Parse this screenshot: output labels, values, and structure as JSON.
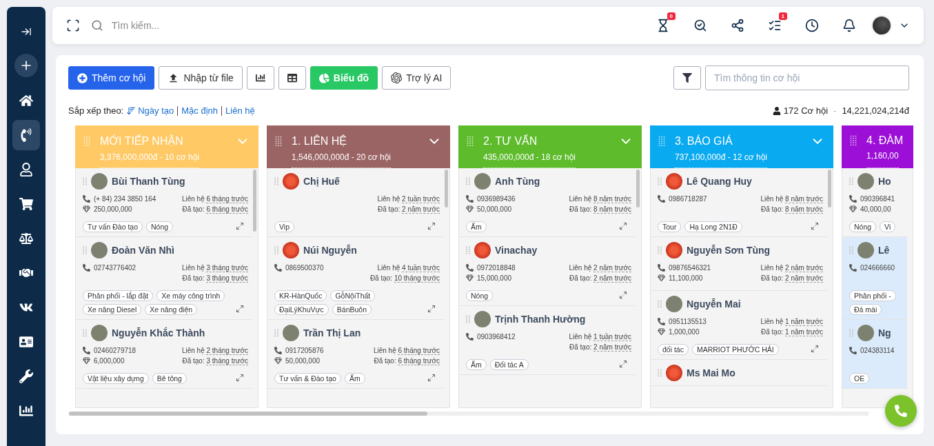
{
  "sidebar": {
    "items": [
      {
        "selected": false
      },
      {
        "selected": false
      },
      {
        "selected": false
      },
      {
        "selected": true
      },
      {
        "selected": false
      },
      {
        "selected": false
      },
      {
        "selected": false
      },
      {
        "selected": false
      },
      {
        "selected": false
      },
      {
        "selected": false
      },
      {
        "selected": false
      },
      {
        "selected": false
      }
    ]
  },
  "topbar": {
    "search": {
      "placeholder": "Tìm kiếm..."
    },
    "badges": [
      "0",
      "1"
    ]
  },
  "toolbar": {
    "buttons": [
      {
        "kind": "primary",
        "label": "Thêm cơ hội"
      },
      {
        "kind": "outline",
        "label": "Nhập từ file"
      },
      {
        "kind": "icon"
      },
      {
        "kind": "icon"
      },
      {
        "kind": "success",
        "label": "Biểu đồ"
      },
      {
        "kind": "outline",
        "label": "Trợ lý AI"
      }
    ],
    "search": {
      "placeholder": "Tìm thông tin cơ hội"
    }
  },
  "sort": {
    "label": "Sắp xếp theo:",
    "options": [
      "Ngày tạo",
      "Mặc định",
      "Liên hệ"
    ]
  },
  "stats": {
    "count": "172 Cơ hội",
    "separator": "·",
    "total": "14,221,024,214đ"
  },
  "columns": [
    {
      "title": "MỚI TIẾP NHẬN",
      "summary": "3,376,000,000đ - 10 cơ hội",
      "color": "#ffc966",
      "cards": [
        {
          "name": "Bùi Thanh Tùng",
          "kind": "photo",
          "phone": "(+ 84) 234 3850 164",
          "value": "250,000,000",
          "contact": [
            "Liên hệ",
            "6 tháng trước"
          ],
          "created": [
            "Đã tạo:",
            "6 tháng trước"
          ],
          "tags": [
            "Tư vấn Đào tạo",
            "Nóng"
          ],
          "highlighted": false
        },
        {
          "name": "Đoàn Văn Nhì",
          "kind": "photo",
          "phone": "02743776402",
          "contact": [
            "Liên hệ",
            "3 tháng trước"
          ],
          "created": [
            "Đã tạo:",
            "3 tháng trước"
          ],
          "tags": [
            "Phân phối - lắp đặt",
            "Xe máy công trình",
            "Xe nâng Diesel",
            "Xe nâng điện"
          ],
          "highlighted": false
        },
        {
          "name": "Nguyễn Khắc Thành",
          "kind": "photo",
          "phone": "02460279718",
          "value": "6,000,000",
          "contact": [
            "Liên hệ",
            "2 tháng trước"
          ],
          "created": [
            "Đã tạo:",
            "3 tháng trước"
          ],
          "tags": [
            "Vật liệu xây dựng",
            "Bê tông"
          ],
          "highlighted": false
        }
      ]
    },
    {
      "title": "1. LIÊN HỆ",
      "summary": "1,546,000,000đ - 20 cơ hội",
      "color": "#9b6464",
      "cards": [
        {
          "name": "Chị Huế",
          "kind": "logo",
          "contact": [
            "Liên hệ",
            "2 tuần trước"
          ],
          "created": [
            "Đã tạo:",
            "2 năm trước"
          ],
          "tags": [
            "Vip"
          ],
          "highlighted": false
        },
        {
          "name": "Núi Nguyễn",
          "kind": "logo",
          "phone": "0869500370",
          "contact": [
            "Liên hệ",
            "4 tuần trước"
          ],
          "created": [
            "Đã tạo:",
            "10 tháng trước"
          ],
          "tags": [
            "KR-HànQuốc",
            "GỗNộiThất",
            "ĐạiLýKhuVực",
            "BánBuôn"
          ],
          "highlighted": false
        },
        {
          "name": "Trần Thị Lan",
          "kind": "photo",
          "phone": "0917205876",
          "value": "50,000,000",
          "contact": [
            "Liên hệ",
            "6 tháng trước"
          ],
          "created": [
            "Đã tạo:",
            "6 tháng trước"
          ],
          "tags": [
            "Tư vấn & Đào tạo",
            "Ấm"
          ],
          "highlighted": false
        }
      ]
    },
    {
      "title": "2. TƯ VẤN",
      "summary": "435,000,000đ - 18 cơ hội",
      "color": "#5dbb2c",
      "cards": [
        {
          "name": "Anh Tùng",
          "kind": "photo",
          "phone": "0936989436",
          "value": "50,000,000",
          "contact": [
            "Liên hệ",
            "8 năm trước"
          ],
          "created": [
            "Đã tạo:",
            "8 năm trước"
          ],
          "tags": [
            "Ấm"
          ],
          "highlighted": false
        },
        {
          "name": "Vinachay",
          "kind": "logo",
          "phone": "0972018848",
          "value": "15,000,000",
          "contact": [
            "Liên hệ",
            "2 năm trước"
          ],
          "created": [
            "Đã tạo:",
            "2 năm trước"
          ],
          "tags": [
            "Nóng"
          ],
          "highlighted": false
        },
        {
          "name": "Trịnh Thanh Hường",
          "kind": "photo",
          "phone": "0903968412",
          "contact": [
            "Liên hệ",
            "1 tuần trước"
          ],
          "created": [
            "Đã tạo:",
            "2 năm trước"
          ],
          "tags": [
            "Ấm",
            "Đối tác A"
          ],
          "highlighted": false
        }
      ]
    },
    {
      "title": "3. BÁO GIÁ",
      "summary": "737,100,000đ - 12 cơ hội",
      "color": "#0aaaf0",
      "cards": [
        {
          "name": "Lê Quang Huy",
          "kind": "logo",
          "phone": "0986718287",
          "contact": [
            "Liên hệ",
            "8 năm trước"
          ],
          "created": [
            "Đã tạo:",
            "8 năm trước"
          ],
          "tags": [
            "Tour",
            "Hạ Long 2N1Đ"
          ],
          "highlighted": false
        },
        {
          "name": "Nguyễn Sơn Tùng",
          "kind": "logo",
          "phone": "09876546321",
          "value": "11,100,000",
          "contact": [
            "Liên hệ",
            "2 năm trước"
          ],
          "created": [
            "Đã tạo:",
            "2 năm trước"
          ],
          "highlighted": false
        },
        {
          "name": "Nguyễn Mai",
          "kind": "photo",
          "phone": "0951135513",
          "value": "1,000,000",
          "contact": [
            "Liên hệ",
            "1 năm trước"
          ],
          "created": [
            "Đã tạo:",
            "1 năm trước"
          ],
          "tags": [
            "đối tác",
            "MARRIOT PHƯỚC HẢI"
          ],
          "highlighted": false
        },
        {
          "name": "Ms Mai Mo",
          "kind": "logo",
          "highlighted": false
        }
      ]
    },
    {
      "title": "4. ĐÀM",
      "summary": "1,160,00",
      "color": "#9b0fd6",
      "cards": [
        {
          "name": "Ho",
          "kind": "photo",
          "phone": "090396841",
          "value": "40,000,00",
          "tags": [
            "Nóng",
            "Vi"
          ],
          "highlighted": false
        },
        {
          "name": "Lê",
          "kind": "photo",
          "phone": "024666660",
          "tags": [
            "Phân phối -",
            "Đá mài"
          ],
          "highlighted": true
        },
        {
          "name": "Ng",
          "kind": "photo",
          "phone": "024383114",
          "tags": [
            "OE"
          ],
          "highlighted": true
        }
      ]
    }
  ]
}
